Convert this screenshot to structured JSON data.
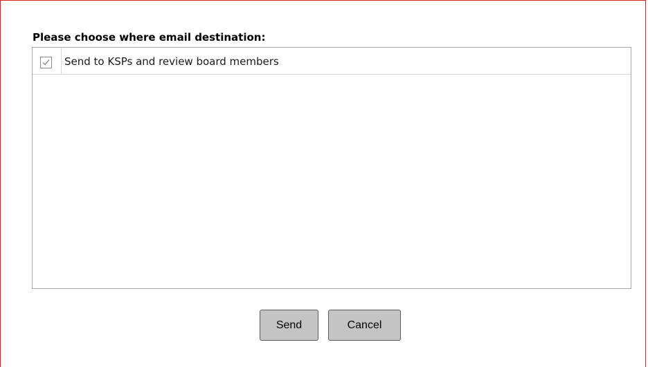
{
  "dialog": {
    "prompt": "Please choose where email destination:",
    "border_color": "#e02020"
  },
  "destinations": {
    "items": [
      {
        "label": "Send to KSPs and review board members",
        "checked": true
      }
    ]
  },
  "actions": {
    "send_label": "Send",
    "cancel_label": "Cancel"
  }
}
